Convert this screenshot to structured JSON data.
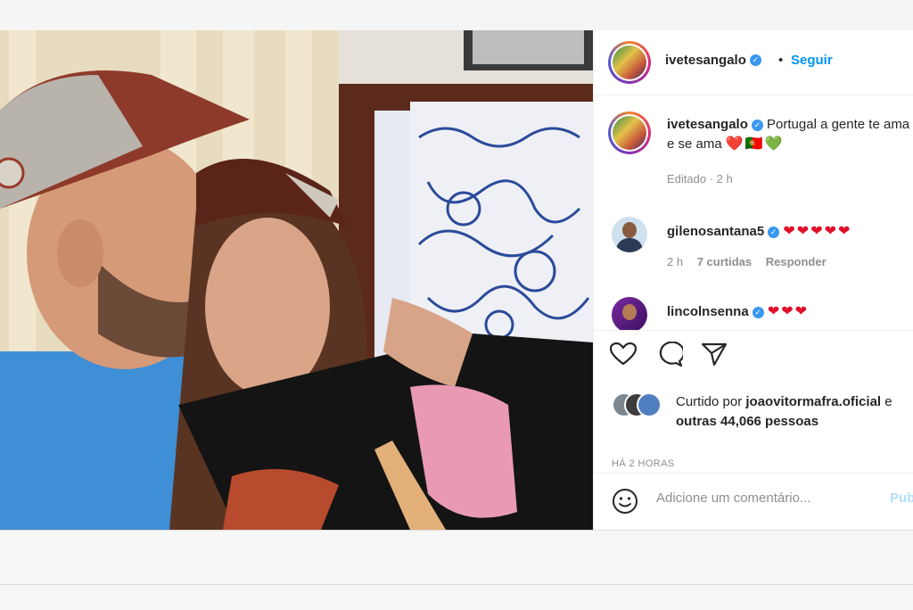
{
  "post": {
    "author": "ivetesangalo",
    "follow_label": "Seguir",
    "follow_separator": "•",
    "caption_username": "ivetesangalo",
    "caption_text": "Portugal a gente te ama e se ama",
    "caption_emojis": "❤️🇵🇹💚",
    "caption_meta": "Editado · 2 h"
  },
  "comments": [
    {
      "username": "gilenosantana5",
      "text": "❤❤❤❤❤",
      "time": "2 h",
      "likes": "7 curtidas",
      "reply": "Responder"
    },
    {
      "username": "lincolnsenna",
      "text": "❤❤❤"
    }
  ],
  "likes": {
    "prefix": "Curtido por",
    "user": "joaovitormafra.oficial",
    "connector": "e",
    "others": "outras 44,066 pessoas",
    "posted": "HÁ 2 HORAS"
  },
  "comment_input": {
    "placeholder": "Adicione um comentário...",
    "publish": "Publicar"
  },
  "icons": {
    "like": "heart-outline-icon",
    "comment": "comment-bubble-icon",
    "share": "paper-plane-icon",
    "emoji": "smiley-icon"
  },
  "colors": {
    "link_blue": "#0095f6",
    "verified_blue": "#3897f0",
    "heart_red": "#e0102a"
  }
}
